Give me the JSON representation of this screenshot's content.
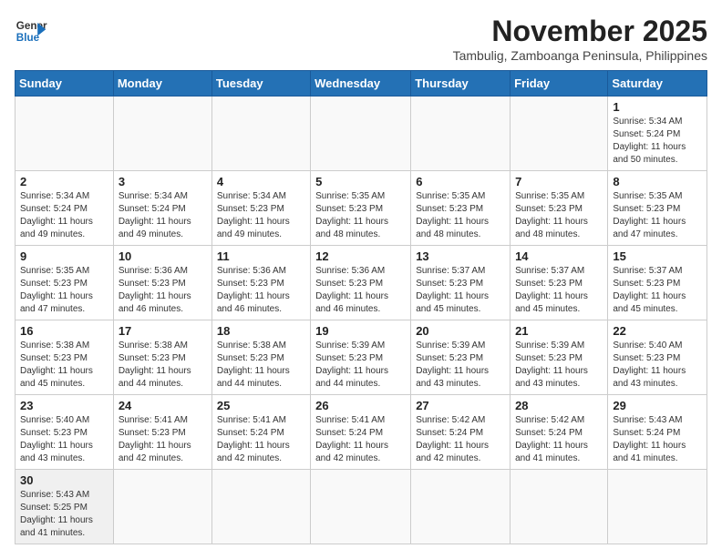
{
  "header": {
    "logo_text_general": "General",
    "logo_text_blue": "Blue",
    "month_title": "November 2025",
    "location": "Tambulig, Zamboanga Peninsula, Philippines"
  },
  "weekdays": [
    "Sunday",
    "Monday",
    "Tuesday",
    "Wednesday",
    "Thursday",
    "Friday",
    "Saturday"
  ],
  "weeks": [
    [
      {
        "day": "",
        "text": ""
      },
      {
        "day": "",
        "text": ""
      },
      {
        "day": "",
        "text": ""
      },
      {
        "day": "",
        "text": ""
      },
      {
        "day": "",
        "text": ""
      },
      {
        "day": "",
        "text": ""
      },
      {
        "day": "1",
        "text": "Sunrise: 5:34 AM\nSunset: 5:24 PM\nDaylight: 11 hours and 50 minutes."
      }
    ],
    [
      {
        "day": "2",
        "text": "Sunrise: 5:34 AM\nSunset: 5:24 PM\nDaylight: 11 hours and 49 minutes."
      },
      {
        "day": "3",
        "text": "Sunrise: 5:34 AM\nSunset: 5:24 PM\nDaylight: 11 hours and 49 minutes."
      },
      {
        "day": "4",
        "text": "Sunrise: 5:34 AM\nSunset: 5:23 PM\nDaylight: 11 hours and 49 minutes."
      },
      {
        "day": "5",
        "text": "Sunrise: 5:35 AM\nSunset: 5:23 PM\nDaylight: 11 hours and 48 minutes."
      },
      {
        "day": "6",
        "text": "Sunrise: 5:35 AM\nSunset: 5:23 PM\nDaylight: 11 hours and 48 minutes."
      },
      {
        "day": "7",
        "text": "Sunrise: 5:35 AM\nSunset: 5:23 PM\nDaylight: 11 hours and 48 minutes."
      },
      {
        "day": "8",
        "text": "Sunrise: 5:35 AM\nSunset: 5:23 PM\nDaylight: 11 hours and 47 minutes."
      }
    ],
    [
      {
        "day": "9",
        "text": "Sunrise: 5:35 AM\nSunset: 5:23 PM\nDaylight: 11 hours and 47 minutes."
      },
      {
        "day": "10",
        "text": "Sunrise: 5:36 AM\nSunset: 5:23 PM\nDaylight: 11 hours and 46 minutes."
      },
      {
        "day": "11",
        "text": "Sunrise: 5:36 AM\nSunset: 5:23 PM\nDaylight: 11 hours and 46 minutes."
      },
      {
        "day": "12",
        "text": "Sunrise: 5:36 AM\nSunset: 5:23 PM\nDaylight: 11 hours and 46 minutes."
      },
      {
        "day": "13",
        "text": "Sunrise: 5:37 AM\nSunset: 5:23 PM\nDaylight: 11 hours and 45 minutes."
      },
      {
        "day": "14",
        "text": "Sunrise: 5:37 AM\nSunset: 5:23 PM\nDaylight: 11 hours and 45 minutes."
      },
      {
        "day": "15",
        "text": "Sunrise: 5:37 AM\nSunset: 5:23 PM\nDaylight: 11 hours and 45 minutes."
      }
    ],
    [
      {
        "day": "16",
        "text": "Sunrise: 5:38 AM\nSunset: 5:23 PM\nDaylight: 11 hours and 45 minutes."
      },
      {
        "day": "17",
        "text": "Sunrise: 5:38 AM\nSunset: 5:23 PM\nDaylight: 11 hours and 44 minutes."
      },
      {
        "day": "18",
        "text": "Sunrise: 5:38 AM\nSunset: 5:23 PM\nDaylight: 11 hours and 44 minutes."
      },
      {
        "day": "19",
        "text": "Sunrise: 5:39 AM\nSunset: 5:23 PM\nDaylight: 11 hours and 44 minutes."
      },
      {
        "day": "20",
        "text": "Sunrise: 5:39 AM\nSunset: 5:23 PM\nDaylight: 11 hours and 43 minutes."
      },
      {
        "day": "21",
        "text": "Sunrise: 5:39 AM\nSunset: 5:23 PM\nDaylight: 11 hours and 43 minutes."
      },
      {
        "day": "22",
        "text": "Sunrise: 5:40 AM\nSunset: 5:23 PM\nDaylight: 11 hours and 43 minutes."
      }
    ],
    [
      {
        "day": "23",
        "text": "Sunrise: 5:40 AM\nSunset: 5:23 PM\nDaylight: 11 hours and 43 minutes."
      },
      {
        "day": "24",
        "text": "Sunrise: 5:41 AM\nSunset: 5:23 PM\nDaylight: 11 hours and 42 minutes."
      },
      {
        "day": "25",
        "text": "Sunrise: 5:41 AM\nSunset: 5:24 PM\nDaylight: 11 hours and 42 minutes."
      },
      {
        "day": "26",
        "text": "Sunrise: 5:41 AM\nSunset: 5:24 PM\nDaylight: 11 hours and 42 minutes."
      },
      {
        "day": "27",
        "text": "Sunrise: 5:42 AM\nSunset: 5:24 PM\nDaylight: 11 hours and 42 minutes."
      },
      {
        "day": "28",
        "text": "Sunrise: 5:42 AM\nSunset: 5:24 PM\nDaylight: 11 hours and 41 minutes."
      },
      {
        "day": "29",
        "text": "Sunrise: 5:43 AM\nSunset: 5:24 PM\nDaylight: 11 hours and 41 minutes."
      }
    ],
    [
      {
        "day": "30",
        "text": "Sunrise: 5:43 AM\nSunset: 5:25 PM\nDaylight: 11 hours and 41 minutes."
      },
      {
        "day": "",
        "text": ""
      },
      {
        "day": "",
        "text": ""
      },
      {
        "day": "",
        "text": ""
      },
      {
        "day": "",
        "text": ""
      },
      {
        "day": "",
        "text": ""
      },
      {
        "day": "",
        "text": ""
      }
    ]
  ]
}
